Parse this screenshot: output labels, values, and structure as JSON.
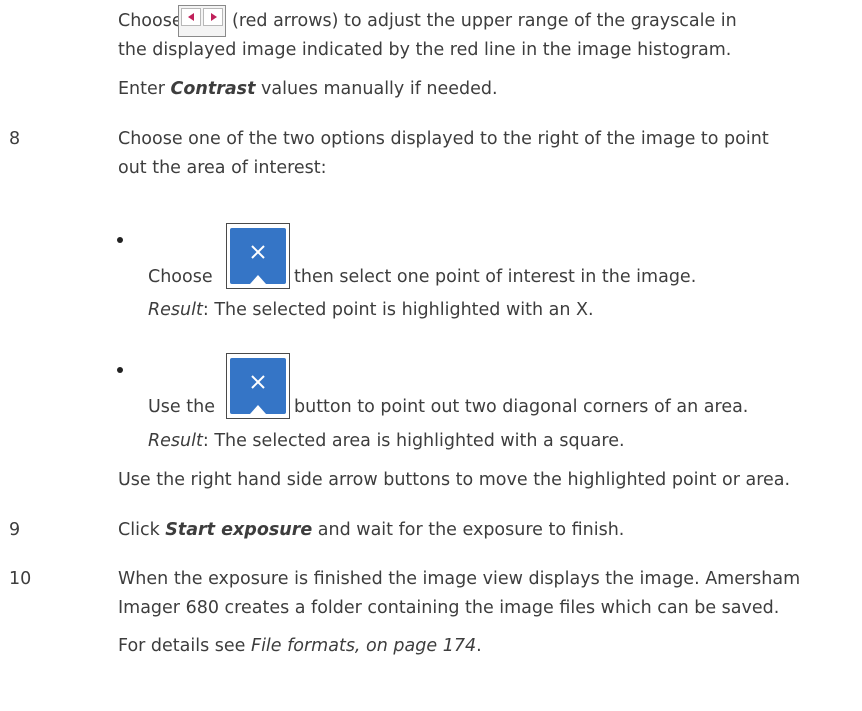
{
  "contrast": {
    "choose": "Choose",
    "arrow_button_icon": "red-left-right-arrow-buttons",
    "line1_rest": "(red arrows) to adjust the upper range of the grayscale in",
    "line2": "the displayed image indicated by the red line in the image histogram.",
    "enter_prefix": "Enter ",
    "enter_bold": "Contrast",
    "enter_suffix": " values manually if needed."
  },
  "step8": {
    "number": "8",
    "line1": "Choose one of the two options displayed to the right of the image to point",
    "line2": "out the area of interest:",
    "option1": {
      "prefix": "Choose",
      "icon": "point-tool-icon",
      "suffix": "then select one point of interest in the image.",
      "result_label": "Result",
      "result_text": ": The selected point is highlighted with an X."
    },
    "option2": {
      "prefix": "Use the",
      "icon": "area-tool-icon",
      "suffix": "button to point out two diagonal corners of an area.",
      "result_label": "Result",
      "result_text": ": The selected area is highlighted with a square."
    },
    "footer": "Use the right hand side arrow buttons to move the highlighted point or area."
  },
  "step9": {
    "number": "9",
    "prefix": "Click ",
    "bold": "Start exposure",
    "suffix": " and wait for the exposure to finish."
  },
  "step10": {
    "number": "10",
    "line1": "When the exposure is finished the image view displays the image. Amersham",
    "line2": "Imager 680 creates a folder containing the image files which can be saved.",
    "details_prefix": "For details see ",
    "details_link": "File formats, on page 174",
    "details_suffix": "."
  },
  "colors": {
    "text": "#3d3d3d",
    "tool_button": "#3575c6",
    "arrow_red": "#c0205a"
  }
}
